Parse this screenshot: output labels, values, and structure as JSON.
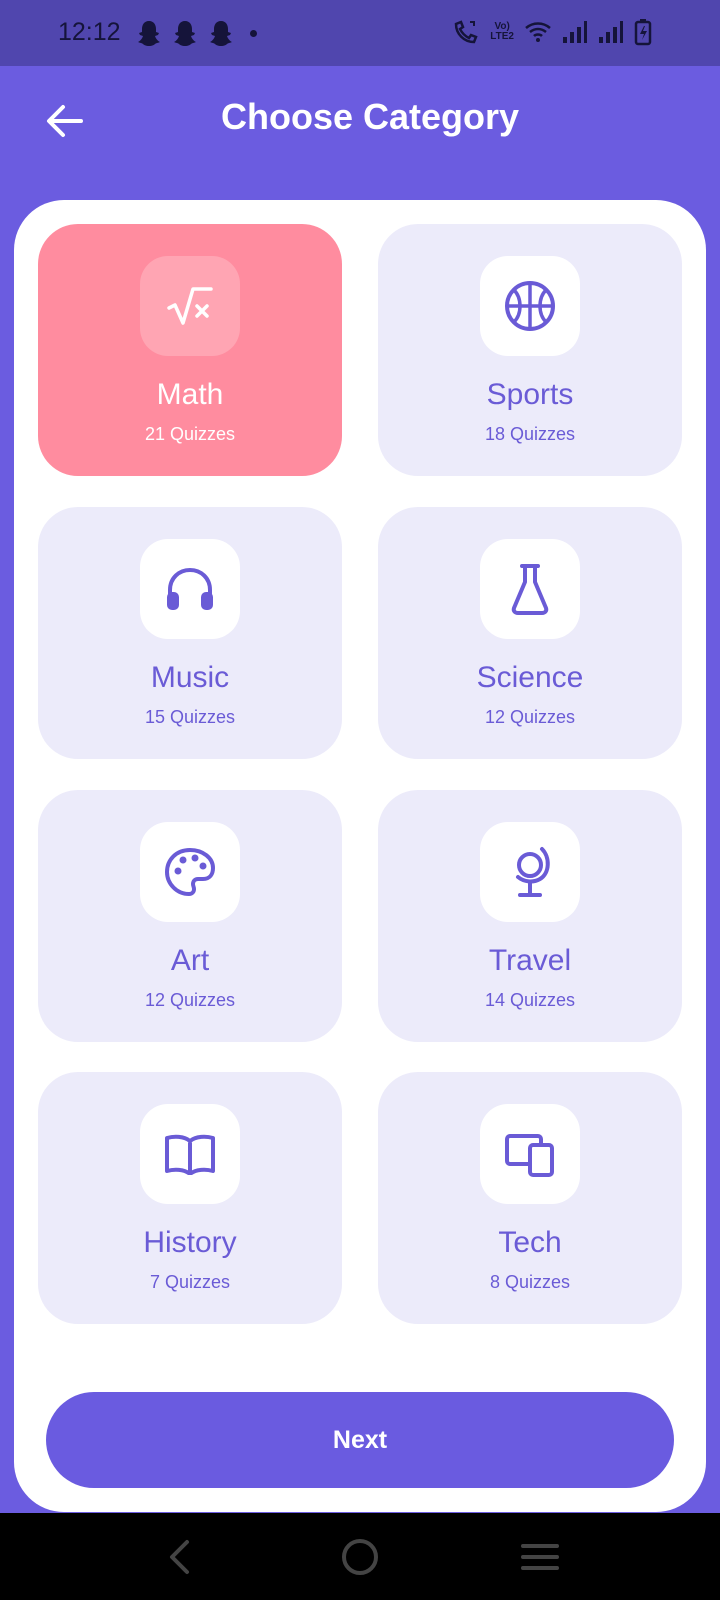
{
  "status_bar": {
    "time": "12:12",
    "lte_top": "Vo)",
    "lte_bottom": "LTE2"
  },
  "header": {
    "title": "Choose Category",
    "back_icon": "arrow-left-icon"
  },
  "categories": [
    {
      "name": "Math",
      "count": "21 Quizzes",
      "icon": "square-root-icon",
      "selected": true
    },
    {
      "name": "Sports",
      "count": "18 Quizzes",
      "icon": "basketball-icon",
      "selected": false
    },
    {
      "name": "Music",
      "count": "15 Quizzes",
      "icon": "headphones-icon",
      "selected": false
    },
    {
      "name": "Science",
      "count": "12 Quizzes",
      "icon": "flask-icon",
      "selected": false
    },
    {
      "name": "Art",
      "count": "12 Quizzes",
      "icon": "palette-icon",
      "selected": false
    },
    {
      "name": "Travel",
      "count": "14 Quizzes",
      "icon": "globe-icon",
      "selected": false
    },
    {
      "name": "History",
      "count": "7 Quizzes",
      "icon": "book-icon",
      "selected": false
    },
    {
      "name": "Tech",
      "count": "8 Quizzes",
      "icon": "devices-icon",
      "selected": false
    }
  ],
  "next_button": {
    "label": "Next"
  },
  "colors": {
    "primary": "#6B5CE0",
    "selected_tile": "#FF8C9F",
    "tile_bg": "#ECEBFA",
    "status_bar_bg": "#5046AE"
  },
  "nav": {
    "back_icon": "nav-back-icon",
    "home_icon": "nav-home-icon",
    "menu_icon": "nav-menu-icon"
  }
}
